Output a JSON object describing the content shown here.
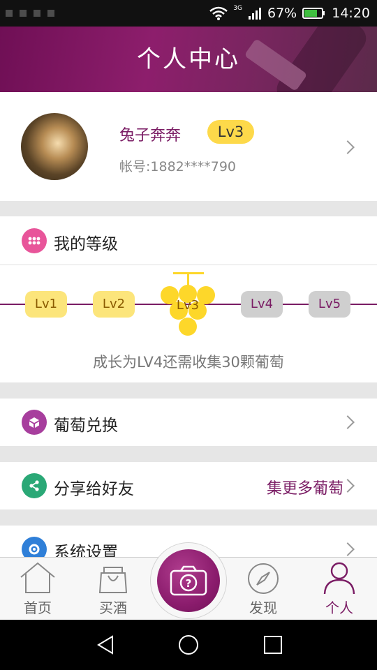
{
  "status_bar": {
    "battery": "67%",
    "time": "14:20",
    "network": "3G"
  },
  "header": {
    "title": "个人中心"
  },
  "profile": {
    "name": "兔子奔奔",
    "level": "Lv3",
    "account": "帐号:1882****790"
  },
  "level_section": {
    "title": "我的等级",
    "levels": [
      "Lv1",
      "Lv2",
      "Lv3",
      "Lv4",
      "Lv5"
    ],
    "current_level": "Lv3",
    "growth_text": "成长为LV4还需收集30颗葡萄"
  },
  "menu": {
    "grape_exchange": "葡萄兑换",
    "share": "分享给好友",
    "share_extra": "集更多葡萄",
    "settings": "系统设置"
  },
  "bottom_nav": {
    "home": "首页",
    "buy": "买酒",
    "discover": "发现",
    "me": "个人",
    "active": "个人"
  },
  "colors": {
    "brand": "#7a1c64",
    "gold": "#fdd94a",
    "share_icon": "#2aa876",
    "settings_icon": "#2f7fd8",
    "level_icon": "#e8559a",
    "exchange_icon": "#a73e9d"
  }
}
